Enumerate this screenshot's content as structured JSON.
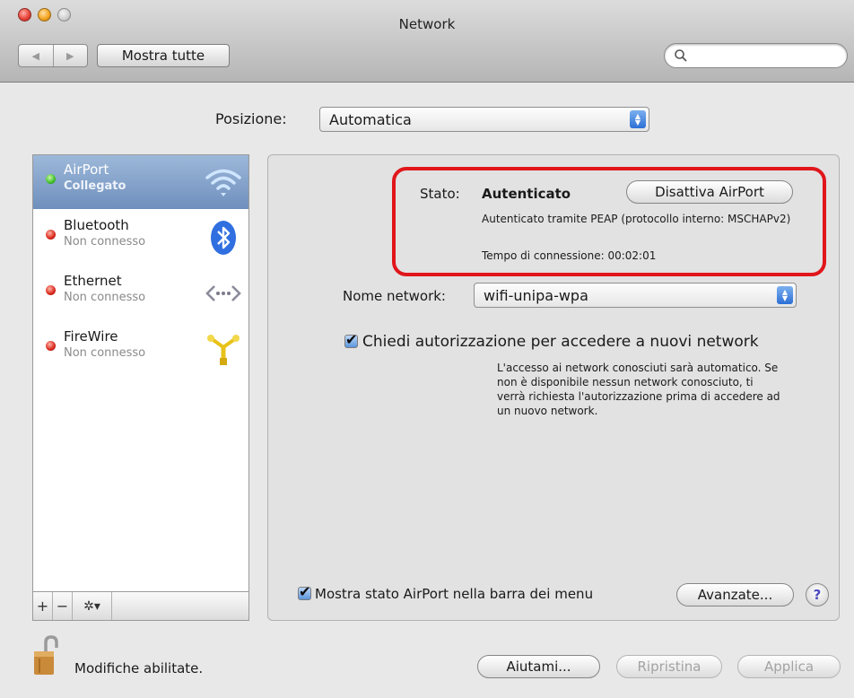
{
  "window": {
    "title": "Network"
  },
  "toolbar": {
    "back_label": "◀",
    "forward_label": "▶",
    "show_all_label": "Mostra tutte",
    "search_placeholder": ""
  },
  "location": {
    "label": "Posizione:",
    "value": "Automatica"
  },
  "services": [
    {
      "name": "AirPort",
      "status": "Collegato",
      "state": "connected",
      "selected": true,
      "icon": "wifi-icon"
    },
    {
      "name": "Bluetooth",
      "status": "Non connesso",
      "state": "disconnected",
      "selected": false,
      "icon": "bluetooth-icon"
    },
    {
      "name": "Ethernet",
      "status": "Non connesso",
      "state": "disconnected",
      "selected": false,
      "icon": "ethernet-icon"
    },
    {
      "name": "FireWire",
      "status": "Non connesso",
      "state": "disconnected",
      "selected": false,
      "icon": "firewire-icon"
    }
  ],
  "sidebar_footer": {
    "add": "+",
    "remove": "−",
    "action": "✲▾"
  },
  "status": {
    "label": "Stato:",
    "value": "Autenticato",
    "toggle_button": "Disattiva AirPort",
    "auth_info": "Autenticato tramite PEAP (protocollo interno: MSCHAPv2)",
    "connection_time": "Tempo di connessione: 00:02:01"
  },
  "network_name": {
    "label": "Nome network:",
    "value": "wifi-unipa-wpa"
  },
  "ask_to_join": {
    "checked": true,
    "label": "Chiedi autorizzazione per accedere a nuovi network",
    "description": "L'accesso ai network conosciuti sarà automatico. Se non è disponibile nessun network conosciuto, ti verrà richiesta l'autorizzazione prima di accedere ad un nuovo network."
  },
  "menu_status": {
    "checked": true,
    "label": "Mostra stato AirPort nella barra dei menu"
  },
  "advanced_button": "Avanzate...",
  "help_button": "?",
  "lock": {
    "text": "Modifiche abilitate."
  },
  "footer_buttons": {
    "assist": "Aiutami...",
    "revert": "Ripristina",
    "apply": "Applica"
  },
  "colors": {
    "selection": "#7e9cc6",
    "highlight_box": "#e0161b",
    "connected": "#3fbf2a",
    "disconnected": "#d8261a"
  }
}
